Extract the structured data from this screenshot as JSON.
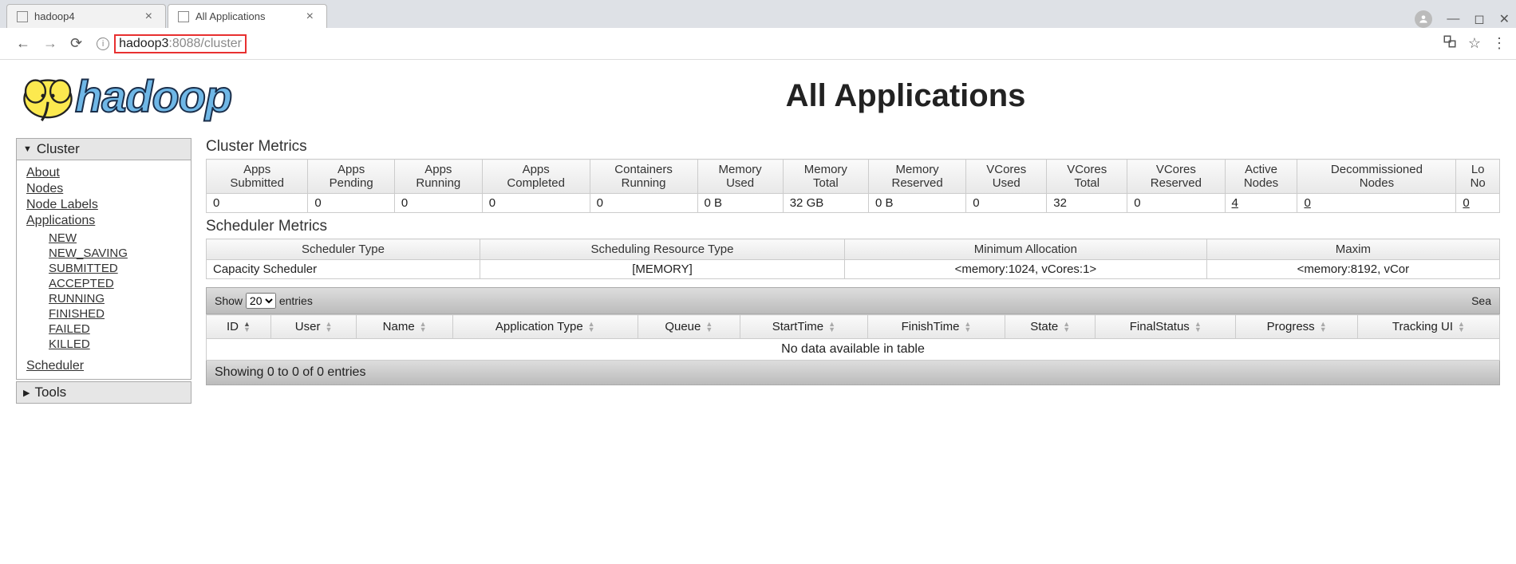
{
  "browser": {
    "tabs": [
      {
        "title": "hadoop4",
        "active": false
      },
      {
        "title": "All Applications",
        "active": true
      }
    ],
    "url_host": "hadoop3",
    "url_rest": ":8088/cluster"
  },
  "page_title": "All Applications",
  "logo_text": "hadoop",
  "sidebar": {
    "cluster_label": "Cluster",
    "tools_label": "Tools",
    "links": {
      "about": "About",
      "nodes": "Nodes",
      "node_labels": "Node Labels",
      "applications": "Applications",
      "scheduler": "Scheduler"
    },
    "app_states": [
      "NEW",
      "NEW_SAVING",
      "SUBMITTED",
      "ACCEPTED",
      "RUNNING",
      "FINISHED",
      "FAILED",
      "KILLED"
    ]
  },
  "cluster_metrics": {
    "title": "Cluster Metrics",
    "headers": [
      "Apps Submitted",
      "Apps Pending",
      "Apps Running",
      "Apps Completed",
      "Containers Running",
      "Memory Used",
      "Memory Total",
      "Memory Reserved",
      "VCores Used",
      "VCores Total",
      "VCores Reserved",
      "Active Nodes",
      "Decommissioned Nodes",
      "Lo No"
    ],
    "values": [
      "0",
      "0",
      "0",
      "0",
      "0",
      "0 B",
      "32 GB",
      "0 B",
      "0",
      "32",
      "0",
      "4",
      "0",
      "0"
    ]
  },
  "scheduler_metrics": {
    "title": "Scheduler Metrics",
    "headers": [
      "Scheduler Type",
      "Scheduling Resource Type",
      "Minimum Allocation",
      "Maxim"
    ],
    "values": [
      "Capacity Scheduler",
      "[MEMORY]",
      "<memory:1024, vCores:1>",
      "<memory:8192, vCor"
    ]
  },
  "datatable": {
    "show_label": "Show",
    "entries_label": "entries",
    "length_value": "20",
    "search_label": "Sea",
    "headers": [
      "ID",
      "User",
      "Name",
      "Application Type",
      "Queue",
      "StartTime",
      "FinishTime",
      "State",
      "FinalStatus",
      "Progress",
      "Tracking UI"
    ],
    "no_data": "No data available in table",
    "footer": "Showing 0 to 0 of 0 entries"
  }
}
